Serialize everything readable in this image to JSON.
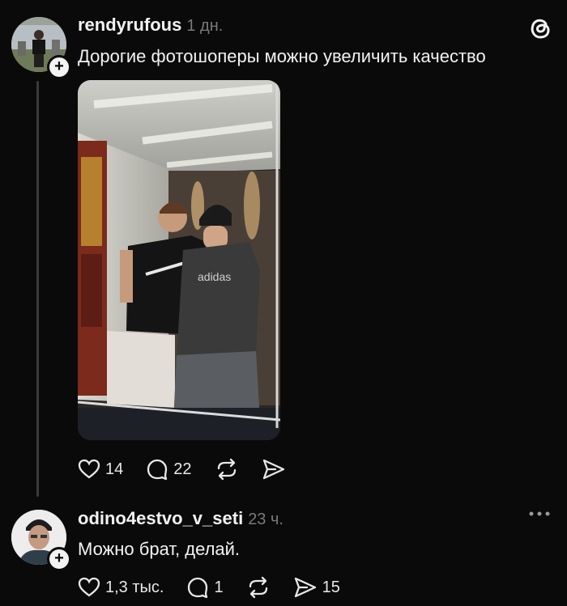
{
  "post": {
    "username": "rendyrufous",
    "time": "1 дн.",
    "text": "Дорогие фотошоперы можно увеличить качество",
    "photo_shirt_text": "adidas",
    "likes": "14",
    "comments": "22"
  },
  "reply": {
    "username": "odino4estvo_v_seti",
    "time": "23 ч.",
    "text": "Можно брат, делай.",
    "likes": "1,3 тыс.",
    "comments": "1",
    "shares": "15"
  },
  "icons": {
    "app_logo": "threads-logo-icon",
    "more": "more-dots-icon",
    "like": "heart-icon",
    "comment": "comment-bubble-icon",
    "repost": "repost-icon",
    "share": "send-icon"
  },
  "colors": {
    "background": "#0a0a0a",
    "text": "#f3f3f3",
    "muted": "#7a7a7a"
  }
}
